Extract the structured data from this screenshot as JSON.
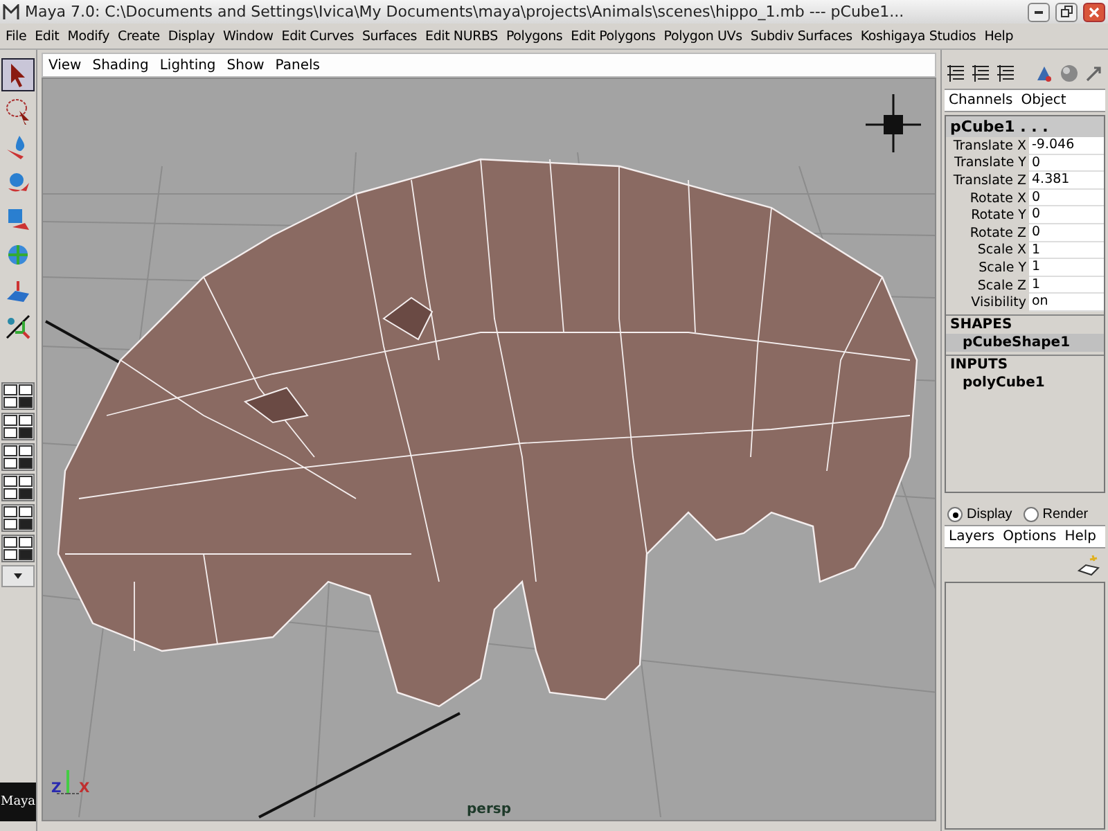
{
  "window": {
    "title": "Maya 7.0: C:\\Documents and Settings\\Ivica\\My Documents\\maya\\projects\\Animals\\scenes\\hippo_1.mb   ---   pCube1..."
  },
  "menu": [
    "File",
    "Edit",
    "Modify",
    "Create",
    "Display",
    "Window",
    "Edit Curves",
    "Surfaces",
    "Edit NURBS",
    "Polygons",
    "Edit Polygons",
    "Polygon UVs",
    "Subdiv Surfaces",
    "Koshigaya Studios",
    "Help"
  ],
  "tools": [
    {
      "kind": "select",
      "selected": true
    },
    {
      "kind": "lasso",
      "selected": false
    },
    {
      "kind": "move",
      "selected": false
    },
    {
      "kind": "rotate",
      "selected": false
    },
    {
      "kind": "scale",
      "selected": false
    },
    {
      "kind": "manip",
      "selected": false
    },
    {
      "kind": "softmod",
      "selected": false
    },
    {
      "kind": "lastused",
      "selected": false
    }
  ],
  "logo": {
    "text": "Maya"
  },
  "viewport": {
    "menu": [
      "View",
      "Shading",
      "Lighting",
      "Show",
      "Panels"
    ],
    "camera": "persp",
    "axis_labels": [
      "Z",
      "X"
    ]
  },
  "channel_box": {
    "tabs": [
      "Channels",
      "Object"
    ],
    "object": "pCube1 . . .",
    "attributes": [
      {
        "name": "Translate X",
        "value": "-9.046"
      },
      {
        "name": "Translate Y",
        "value": "0"
      },
      {
        "name": "Translate Z",
        "value": "4.381"
      },
      {
        "name": "Rotate X",
        "value": "0"
      },
      {
        "name": "Rotate Y",
        "value": "0"
      },
      {
        "name": "Rotate Z",
        "value": "0"
      },
      {
        "name": "Scale X",
        "value": "1"
      },
      {
        "name": "Scale Y",
        "value": "1"
      },
      {
        "name": "Scale Z",
        "value": "1"
      },
      {
        "name": "Visibility",
        "value": "on"
      }
    ],
    "sections": [
      {
        "title": "SHAPES",
        "items": [
          {
            "label": "pCubeShape1",
            "selected": true
          }
        ]
      },
      {
        "title": "INPUTS",
        "items": [
          {
            "label": "polyCube1",
            "selected": false
          }
        ]
      }
    ]
  },
  "layer_editor": {
    "modes": [
      {
        "label": "Display",
        "selected": true
      },
      {
        "label": "Render",
        "selected": false
      }
    ],
    "menu": [
      "Layers",
      "Options",
      "Help"
    ]
  }
}
